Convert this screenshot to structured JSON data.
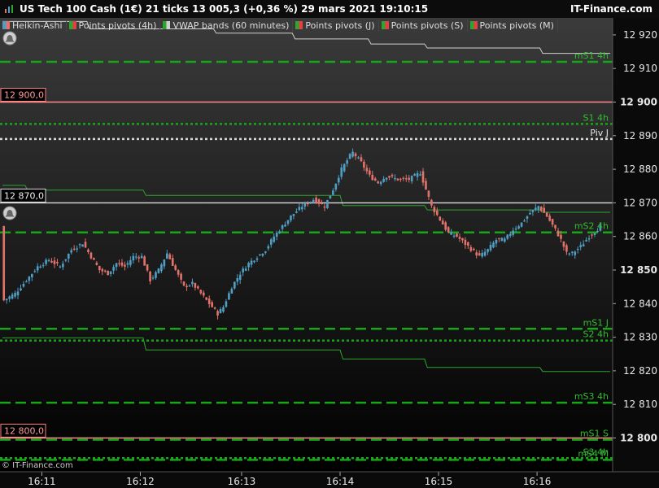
{
  "header": {
    "title": "US Tech 100 Cash (1€) 21 ticks 13 005,3 (+0,36 %) 29 mars 2021 19:10:15",
    "brand": "IT-Finance.com"
  },
  "legend": [
    {
      "label": "Heikin-Ashi",
      "colors": [
        "#4f9ec4",
        "#e2726a"
      ]
    },
    {
      "label": "Points pivots (4h)",
      "colors": [
        "#2ea52e",
        "#e04040"
      ]
    },
    {
      "label": "VWAP bands (60 minutes)",
      "colors": [
        "#2ea52e",
        "#cfcfcf"
      ]
    },
    {
      "label": "Points pivots (J)",
      "colors": [
        "#2ea52e",
        "#e04040"
      ]
    },
    {
      "label": "Points pivots (S)",
      "colors": [
        "#2ea52e",
        "#e04040"
      ]
    },
    {
      "label": "Points pivots (M)",
      "colors": [
        "#2ea52e",
        "#e04040"
      ]
    }
  ],
  "watermark": "© IT-Finance.com",
  "chart_data": {
    "type": "candlestick",
    "ylim": [
      12795,
      12927
    ],
    "y_ticks": [
      {
        "value": 12920,
        "label": "12 920",
        "bold": false
      },
      {
        "value": 12910,
        "label": "12 910",
        "bold": false
      },
      {
        "value": 12900,
        "label": "12 900",
        "bold": true
      },
      {
        "value": 12890,
        "label": "12 890",
        "bold": false
      },
      {
        "value": 12880,
        "label": "12 880",
        "bold": false
      },
      {
        "value": 12870,
        "label": "12 870",
        "bold": false
      },
      {
        "value": 12860,
        "label": "12 860",
        "bold": false
      },
      {
        "value": 12850,
        "label": "12 850",
        "bold": true
      },
      {
        "value": 12840,
        "label": "12 840",
        "bold": false
      },
      {
        "value": 12830,
        "label": "12 830",
        "bold": false
      },
      {
        "value": 12820,
        "label": "12 820",
        "bold": false
      },
      {
        "value": 12810,
        "label": "12 810",
        "bold": false
      },
      {
        "value": 12800,
        "label": "12 800",
        "bold": true
      }
    ],
    "x_ticks": [
      {
        "label": "16:11",
        "bar": 14
      },
      {
        "label": "16:12",
        "bar": 49
      },
      {
        "label": "16:13",
        "bar": 85
      },
      {
        "label": "16:14",
        "bar": 120
      },
      {
        "label": "16:15",
        "bar": 155
      },
      {
        "label": "16:16",
        "bar": 190
      }
    ],
    "bar_count": 216,
    "price_boxes": [
      {
        "label": "12 900,0",
        "value": 12900
      },
      {
        "label": "12 870,0",
        "value": 12870
      },
      {
        "label": "12 800,0",
        "value": 12800
      }
    ],
    "horizontal_levels": [
      {
        "label": "",
        "value": 12900,
        "color": "#ff8a8a",
        "style": "solid"
      },
      {
        "label": "",
        "value": 12870,
        "color": "#dcdcdc",
        "style": "solid"
      },
      {
        "label": "",
        "value": 12800,
        "color": "#ff8a8a",
        "style": "solid"
      },
      {
        "label": "mS1 4h",
        "value": 12912,
        "color": "#16a616",
        "style": "dash"
      },
      {
        "label": "S1 4h",
        "value": 12893.5,
        "color": "#16a616",
        "style": "dot"
      },
      {
        "label": "Piv J",
        "value": 12889,
        "color": "#d8d8d8",
        "style": "dot"
      },
      {
        "label": "mS2 4h",
        "value": 12861.2,
        "color": "#16a616",
        "style": "dash"
      },
      {
        "label": "mS1 J",
        "value": 12832.5,
        "color": "#16a616",
        "style": "dash"
      },
      {
        "label": "S2 4h",
        "value": 12829,
        "color": "#16a616",
        "style": "dot"
      },
      {
        "label": "mS3 4h",
        "value": 12810.5,
        "color": "#16a616",
        "style": "dash"
      },
      {
        "label": "mS1 S",
        "value": 12799.5,
        "color": "#16a616",
        "style": "dash"
      },
      {
        "label": "S3 4h",
        "value": 12794,
        "color": "#16a616",
        "style": "dot"
      },
      {
        "label": "mS4 M",
        "value": 12793.5,
        "color": "#16a616",
        "style": "dash"
      }
    ],
    "vwap_bands": [
      {
        "name": "",
        "color": "#d0d0d0",
        "points": [
          [
            0,
            12924
          ],
          [
            30,
            12924
          ],
          [
            31,
            12921.8
          ],
          [
            75,
            12921.8
          ],
          [
            76,
            12920.5
          ],
          [
            103,
            12920.5
          ],
          [
            104,
            12918.8
          ],
          [
            130,
            12918.8
          ],
          [
            131,
            12917.3
          ],
          [
            150,
            12917.3
          ],
          [
            151,
            12916.1
          ],
          [
            191,
            12916.1
          ],
          [
            192,
            12914.5
          ],
          [
            216,
            12914.5
          ]
        ]
      },
      {
        "name": "",
        "color": "#2ea52e",
        "points": [
          [
            0,
            12875.2
          ],
          [
            8,
            12875.2
          ],
          [
            9,
            12873.8
          ],
          [
            50,
            12873.8
          ],
          [
            51,
            12872.2
          ],
          [
            120,
            12872.2
          ],
          [
            121,
            12869.2
          ],
          [
            150,
            12869.2
          ],
          [
            151,
            12867.9
          ],
          [
            191,
            12867.9
          ],
          [
            192,
            12867.2
          ],
          [
            216,
            12867.2
          ]
        ]
      },
      {
        "name": "",
        "color": "#2ea52e",
        "points": [
          [
            0,
            12829.8
          ],
          [
            50,
            12829.8
          ],
          [
            51,
            12826.2
          ],
          [
            120,
            12826.2
          ],
          [
            121,
            12823.5
          ],
          [
            150,
            12823.5
          ],
          [
            151,
            12821
          ],
          [
            191,
            12821
          ],
          [
            192,
            12819.8
          ],
          [
            216,
            12819.8
          ]
        ]
      }
    ],
    "price_path": [
      [
        0,
        12841
      ],
      [
        4,
        12843
      ],
      [
        8,
        12847
      ],
      [
        12,
        12851
      ],
      [
        16,
        12853
      ],
      [
        20,
        12851
      ],
      [
        24,
        12856
      ],
      [
        28,
        12858
      ],
      [
        31,
        12854
      ],
      [
        34,
        12850
      ],
      [
        37,
        12849
      ],
      [
        40,
        12852
      ],
      [
        43,
        12851
      ],
      [
        46,
        12854
      ],
      [
        49,
        12854
      ],
      [
        52,
        12847
      ],
      [
        55,
        12850
      ],
      [
        58,
        12855
      ],
      [
        61,
        12850
      ],
      [
        64,
        12845
      ],
      [
        67,
        12846
      ],
      [
        70,
        12843
      ],
      [
        73,
        12840
      ],
      [
        76,
        12837
      ],
      [
        78,
        12839
      ],
      [
        81,
        12845
      ],
      [
        84,
        12849
      ],
      [
        87,
        12852
      ],
      [
        90,
        12854
      ],
      [
        93,
        12856
      ],
      [
        96,
        12860
      ],
      [
        99,
        12863
      ],
      [
        102,
        12866
      ],
      [
        106,
        12869
      ],
      [
        110,
        12871
      ],
      [
        114,
        12869
      ],
      [
        117,
        12874
      ],
      [
        120,
        12880
      ],
      [
        123,
        12884
      ],
      [
        124,
        12885
      ],
      [
        127,
        12882
      ],
      [
        130,
        12878
      ],
      [
        133,
        12876
      ],
      [
        136,
        12878
      ],
      [
        140,
        12877
      ],
      [
        144,
        12877
      ],
      [
        148,
        12879
      ],
      [
        150,
        12874
      ],
      [
        152,
        12869
      ],
      [
        155,
        12865
      ],
      [
        158,
        12861
      ],
      [
        161,
        12860
      ],
      [
        165,
        12857
      ],
      [
        169,
        12854
      ],
      [
        172,
        12856
      ],
      [
        175,
        12859
      ],
      [
        178,
        12859
      ],
      [
        181,
        12862
      ],
      [
        184,
        12864
      ],
      [
        187,
        12867
      ],
      [
        190,
        12869
      ],
      [
        193,
        12866
      ],
      [
        196,
        12862
      ],
      [
        198,
        12859
      ],
      [
        200,
        12855
      ],
      [
        202,
        12855
      ],
      [
        205,
        12857
      ],
      [
        208,
        12860
      ],
      [
        212,
        12863
      ]
    ]
  }
}
